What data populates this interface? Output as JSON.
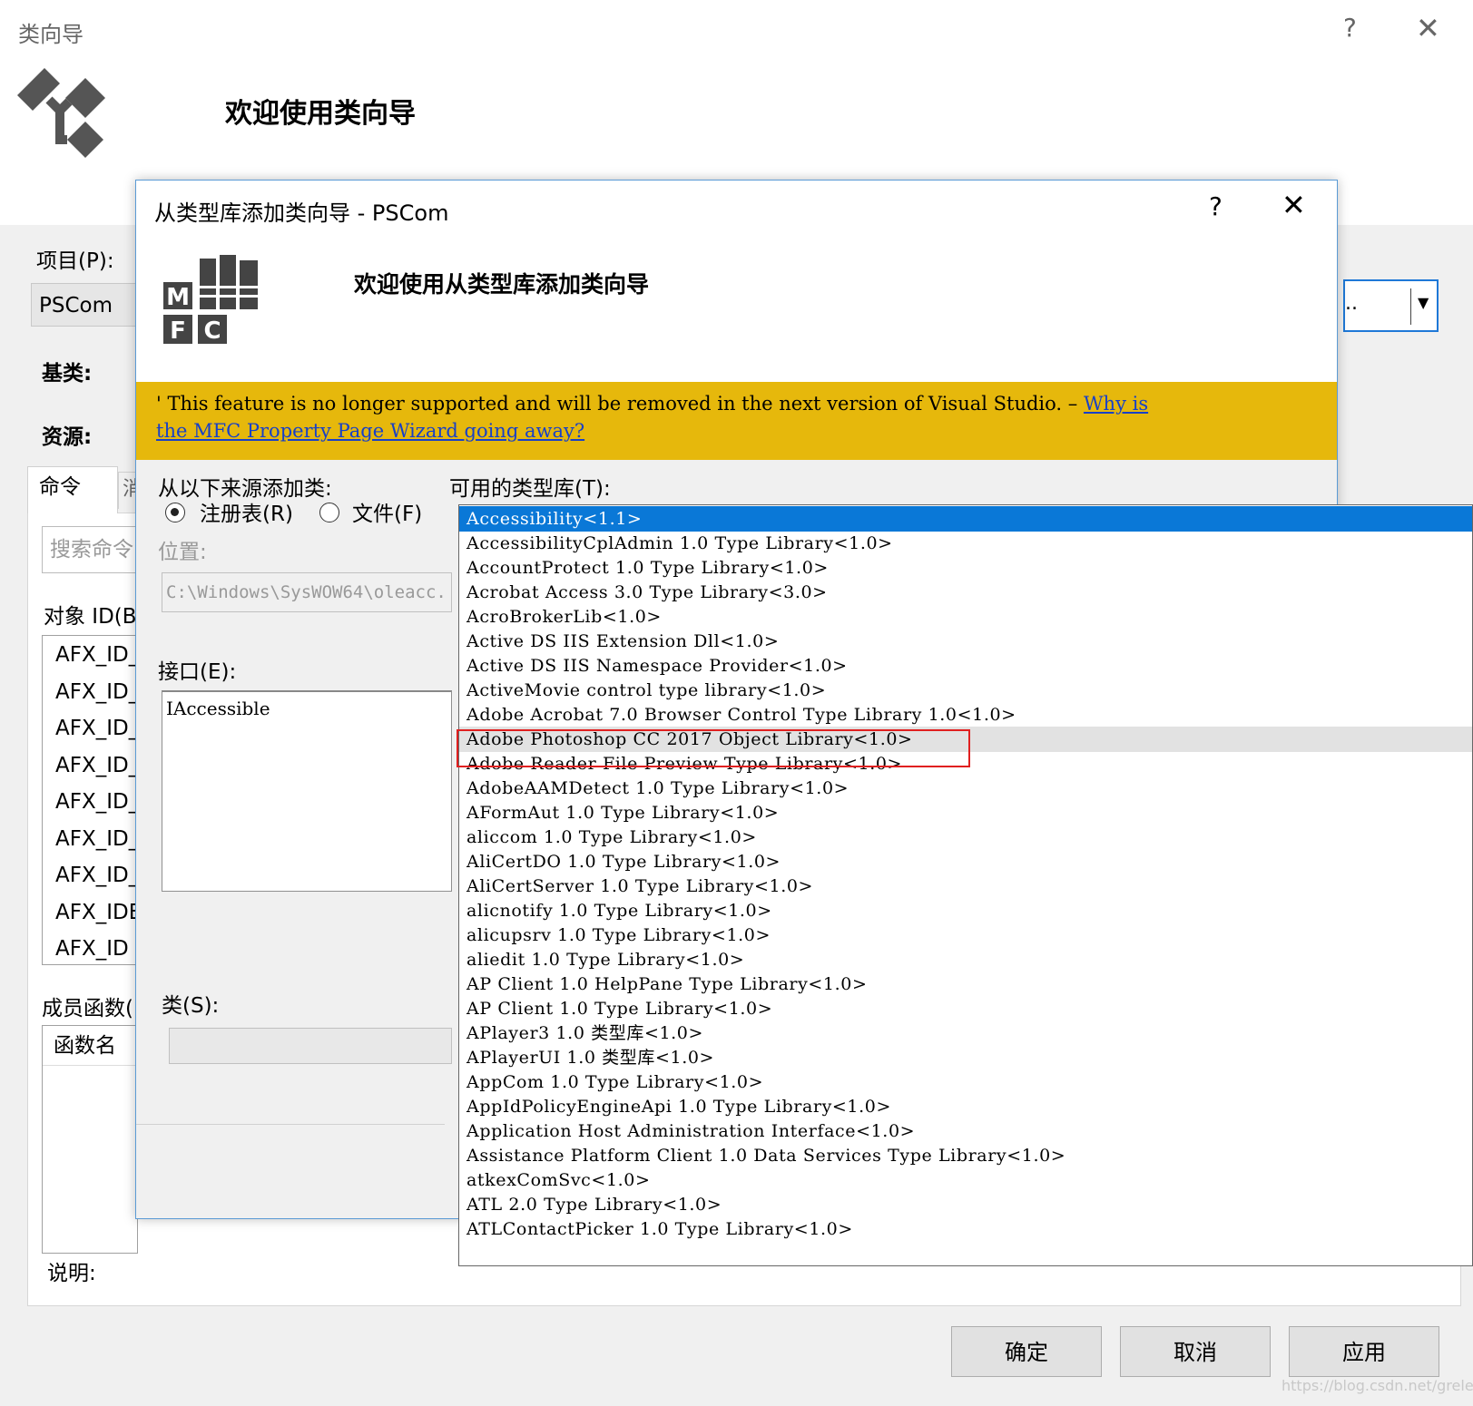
{
  "outer": {
    "title": "类向导",
    "help": "?",
    "close": "✕",
    "welcome": "欢迎使用类向导",
    "project_label": "项目(P):",
    "project_value": "PSCom",
    "base_label": "基类:",
    "resource_label": "资源:",
    "tab_command": "命令",
    "tab_other": "消",
    "search_placeholder": "搜索命令",
    "objid_label": "对象 ID(B",
    "objid_items": [
      "AFX_ID_",
      "AFX_ID_",
      "AFX_ID_",
      "AFX_ID_",
      "AFX_ID_",
      "AFX_ID_",
      "AFX_ID_",
      "AFX_IDE",
      "AFX_ID"
    ],
    "members_label": "成员函数(",
    "members_header": "函数名",
    "desc_label": "说明:",
    "combo_value": "..",
    "buttons": {
      "ok": "确定",
      "cancel": "取消",
      "apply": "应用"
    },
    "watermark": "https://blog.csdn.net/greless"
  },
  "inner": {
    "title": "从类型库添加类向导 - PSCom",
    "help": "?",
    "close": "✕",
    "welcome": "欢迎使用从类型库添加类向导",
    "warning": {
      "icon": "'",
      "text": " This feature is no longer supported and will be removed in the next version of Visual Studio. – ",
      "link_part1": "Why is",
      "link_part2": "the MFC Property Page Wizard going away?"
    },
    "source_label": "从以下来源添加类:",
    "radio_registry": "注册表(R)",
    "radio_file": "文件(F)",
    "location_label": "位置:",
    "location_value": "C:\\Windows\\SysWOW64\\oleacc.",
    "interface_label": "接口(E):",
    "interface_items": [
      "IAccessible"
    ],
    "class_label": "类(S):",
    "available_label": "可用的类型库(T):"
  },
  "typelibs": {
    "items": [
      "Accessibility<1.1>",
      "AccessibilityCplAdmin 1.0 Type Library<1.0>",
      "AccountProtect 1.0 Type Library<1.0>",
      "Acrobat Access 3.0 Type Library<3.0>",
      "AcroBrokerLib<1.0>",
      "Active DS IIS Extension Dll<1.0>",
      "Active DS IIS Namespace Provider<1.0>",
      "ActiveMovie control type library<1.0>",
      "Adobe Acrobat 7.0 Browser Control Type Library 1.0<1.0>",
      "Adobe Photoshop CC 2017 Object Library<1.0>",
      "Adobe Reader File Preview Type Library<1.0>",
      "AdobeAAMDetect 1.0 Type Library<1.0>",
      "AFormAut 1.0 Type Library<1.0>",
      "aliccom 1.0 Type Library<1.0>",
      "AliCertDO 1.0 Type Library<1.0>",
      "AliCertServer 1.0 Type Library<1.0>",
      "alicnotify 1.0 Type Library<1.0>",
      "alicupsrv 1.0 Type Library<1.0>",
      "aliedit 1.0 Type Library<1.0>",
      "AP Client 1.0 HelpPane Type Library<1.0>",
      "AP Client 1.0 Type Library<1.0>",
      "APlayer3 1.0 类型库<1.0>",
      "APlayerUI 1.0 类型库<1.0>",
      "AppCom 1.0 Type Library<1.0>",
      "AppIdPolicyEngineApi 1.0 Type Library<1.0>",
      "Application Host Administration Interface<1.0>",
      "Assistance Platform Client 1.0 Data Services Type Library<1.0>",
      "atkexComSvc<1.0>",
      "ATL 2.0 Type Library<1.0>",
      "ATLContactPicker 1.0 Type Library<1.0>"
    ],
    "selected_index": 0,
    "hover_index": 9,
    "colors": {
      "selected_bg": "#0a78d7",
      "hover_bg": "#e2e2e2",
      "highlight_border": "#e02020",
      "warning_bg": "#e6b80c"
    }
  }
}
